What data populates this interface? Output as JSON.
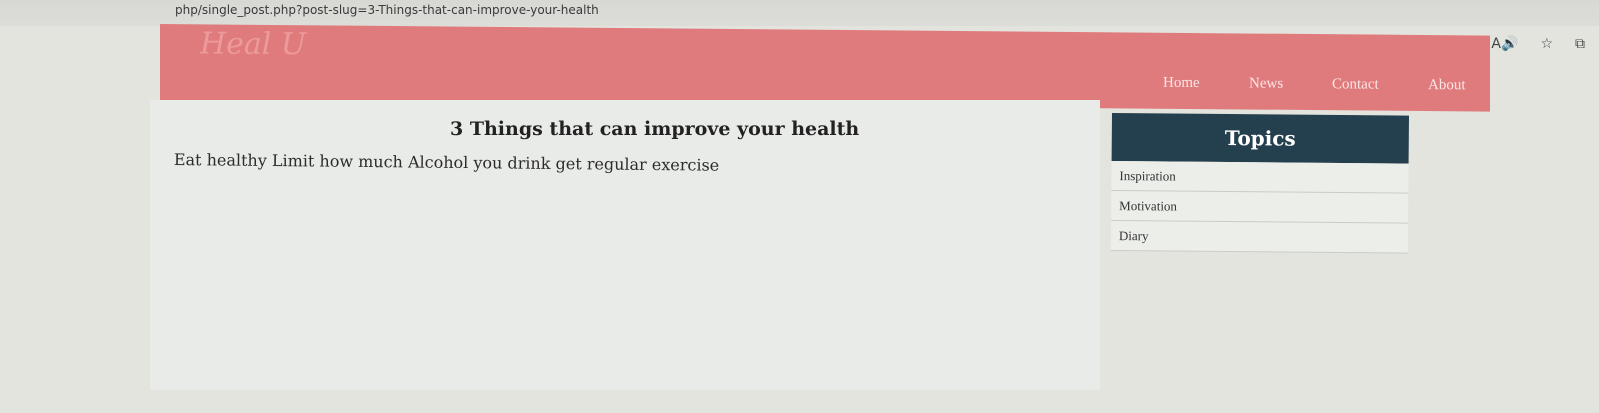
{
  "browser": {
    "url": "php/single_post.php?post-slug=3-Things-that-can-improve-your-health",
    "icons": [
      "read-aloud-icon",
      "favorite-star-icon",
      "collections-icon"
    ]
  },
  "header": {
    "logo": "Heal U",
    "nav": [
      {
        "label": "Home"
      },
      {
        "label": "News"
      },
      {
        "label": "Contact"
      },
      {
        "label": "About"
      }
    ],
    "bg_color": "#e07b7d"
  },
  "post": {
    "title": "3 Things that can improve your health",
    "body": "Eat healthy Limit how much Alcohol you drink get regular exercise"
  },
  "sidebar": {
    "header": "Topics",
    "header_color": "#243f4e",
    "topics": [
      {
        "label": "Inspiration"
      },
      {
        "label": "Motivation"
      },
      {
        "label": "Diary"
      }
    ]
  }
}
